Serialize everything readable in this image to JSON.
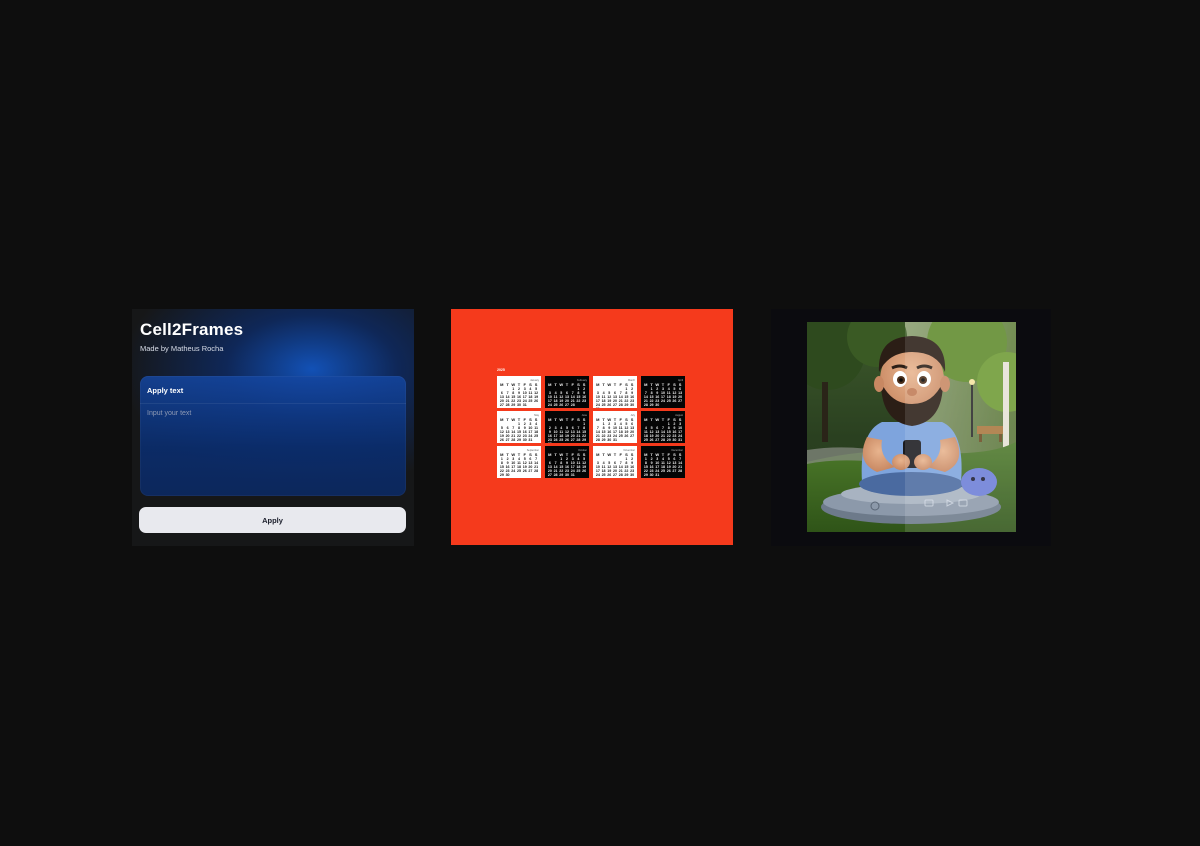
{
  "plugin": {
    "title": "Cell2Frames",
    "subtitle": "Made by Matheus Rocha",
    "card_label": "Apply text",
    "input_placeholder": "Input your text",
    "input_value": "",
    "apply_label": "Apply",
    "accent_color": "#1254be"
  },
  "calendar": {
    "background_color": "#f53a1c",
    "year_label": "2025",
    "weekday_header": [
      "M",
      "T",
      "W",
      "T",
      "F",
      "S",
      "S"
    ],
    "months": [
      {
        "name": "January",
        "theme": "white"
      },
      {
        "name": "February",
        "theme": "black"
      },
      {
        "name": "March",
        "theme": "white"
      },
      {
        "name": "April",
        "theme": "black"
      },
      {
        "name": "May",
        "theme": "white"
      },
      {
        "name": "June",
        "theme": "black"
      },
      {
        "name": "July",
        "theme": "white"
      },
      {
        "name": "August",
        "theme": "black"
      },
      {
        "name": "September",
        "theme": "white"
      },
      {
        "name": "October",
        "theme": "black"
      },
      {
        "name": "November",
        "theme": "white"
      },
      {
        "name": "December",
        "theme": "black"
      }
    ]
  },
  "avatar_image": {
    "description_icon": "avatar-illustration",
    "split_effect": true
  }
}
